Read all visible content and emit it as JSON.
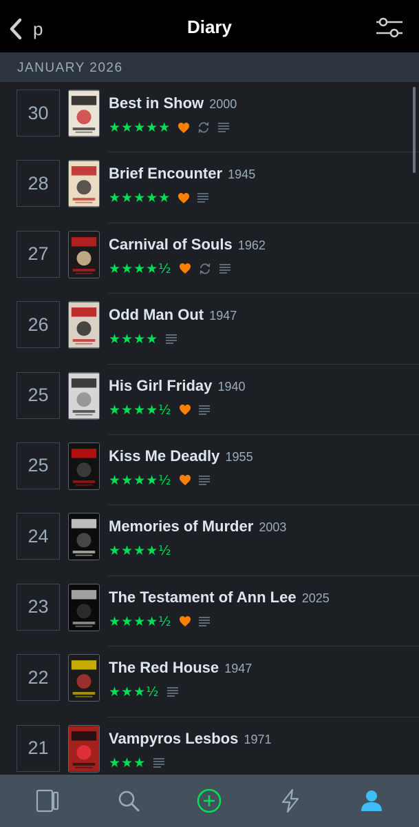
{
  "header": {
    "back_label": "p",
    "title": "Diary"
  },
  "section": {
    "month_label": "JANUARY 2026"
  },
  "colors": {
    "star": "#00e054",
    "heart": "#ff8000",
    "accent_add": "#00e054",
    "profile": "#40bcf4"
  },
  "entries": [
    {
      "day": "30",
      "title": "Best in Show",
      "year": "2000",
      "stars": "★★★★★",
      "rating": 5.0,
      "liked": true,
      "rewatch": true,
      "review": true
    },
    {
      "day": "28",
      "title": "Brief Encounter",
      "year": "1945",
      "stars": "★★★★★",
      "rating": 5.0,
      "liked": true,
      "rewatch": false,
      "review": true
    },
    {
      "day": "27",
      "title": "Carnival of Souls",
      "year": "1962",
      "stars": "★★★★½",
      "rating": 4.5,
      "liked": true,
      "rewatch": true,
      "review": true
    },
    {
      "day": "26",
      "title": "Odd Man Out",
      "year": "1947",
      "stars": "★★★★",
      "rating": 4.0,
      "liked": false,
      "rewatch": false,
      "review": true
    },
    {
      "day": "25",
      "title": "His Girl Friday",
      "year": "1940",
      "stars": "★★★★½",
      "rating": 4.5,
      "liked": true,
      "rewatch": false,
      "review": true
    },
    {
      "day": "25",
      "title": "Kiss Me Deadly",
      "year": "1955",
      "stars": "★★★★½",
      "rating": 4.5,
      "liked": true,
      "rewatch": false,
      "review": true
    },
    {
      "day": "24",
      "title": "Memories of Murder",
      "year": "2003",
      "stars": "★★★★½",
      "rating": 4.5,
      "liked": false,
      "rewatch": false,
      "review": false
    },
    {
      "day": "23",
      "title": "The Testament of Ann Lee",
      "year": "2025",
      "stars": "★★★★½",
      "rating": 4.5,
      "liked": true,
      "rewatch": false,
      "review": true
    },
    {
      "day": "22",
      "title": "The Red House",
      "year": "1947",
      "stars": "★★★½",
      "rating": 3.5,
      "liked": false,
      "rewatch": false,
      "review": true
    },
    {
      "day": "21",
      "title": "Vampyros Lesbos",
      "year": "1971",
      "stars": "★★★",
      "rating": 3.0,
      "liked": false,
      "rewatch": false,
      "review": true
    }
  ],
  "tabbar": {
    "items": [
      {
        "icon": "films-icon",
        "name": "tab-films"
      },
      {
        "icon": "search-icon",
        "name": "tab-search"
      },
      {
        "icon": "add-icon",
        "name": "tab-add"
      },
      {
        "icon": "activity-icon",
        "name": "tab-activity"
      },
      {
        "icon": "profile-icon",
        "name": "tab-profile"
      }
    ]
  }
}
